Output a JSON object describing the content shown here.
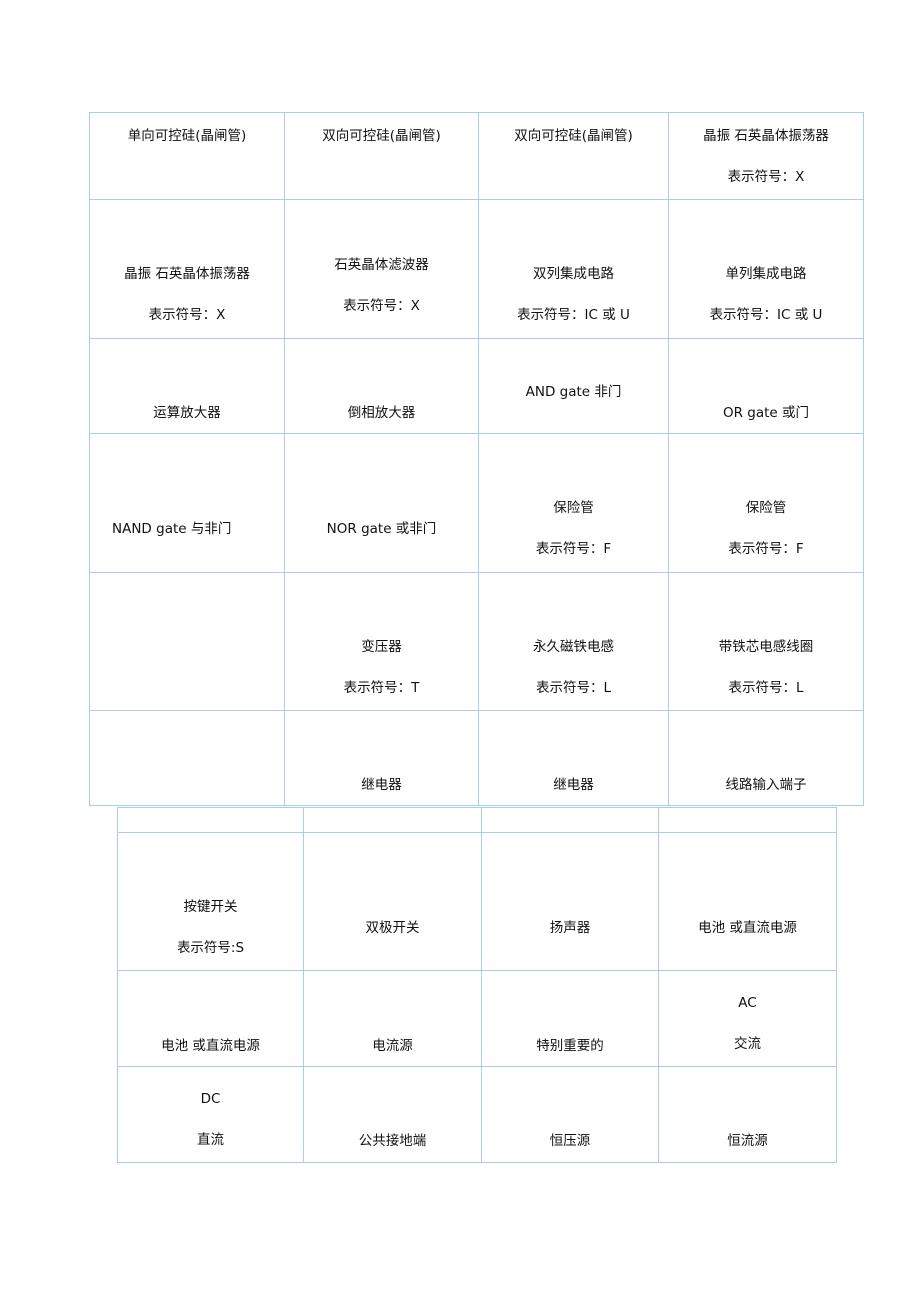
{
  "table1": {
    "rows": [
      [
        {
          "line1": "单向可控硅(晶闸管)",
          "line2": ""
        },
        {
          "line1": "双向可控硅(晶闸管)",
          "line2": ""
        },
        {
          "line1": "双向可控硅(晶闸管)",
          "line2": ""
        },
        {
          "line1": "晶振  石英晶体振荡器",
          "line2": "表示符号：X"
        }
      ],
      [
        {
          "line1": "晶振  石英晶体振荡器",
          "line2": "表示符号：X"
        },
        {
          "line1": "石英晶体滤波器",
          "line2": "表示符号：X"
        },
        {
          "line1": "双列集成电路",
          "line2": "表示符号：IC 或 U"
        },
        {
          "line1": "单列集成电路",
          "line2": "表示符号：IC 或 U"
        }
      ],
      [
        {
          "line1": "运算放大器",
          "line2": ""
        },
        {
          "line1": "倒相放大器",
          "line2": ""
        },
        {
          "line1": "AND gate  非门",
          "line2": ""
        },
        {
          "line1": "OR gate  或门",
          "line2": ""
        }
      ],
      [
        {
          "line1": "NAND gate 与非门",
          "line2": ""
        },
        {
          "line1": "NOR gate  或非门",
          "line2": ""
        },
        {
          "line1": "保险管",
          "line2": "表示符号：F"
        },
        {
          "line1": "保险管",
          "line2": "表示符号：F"
        }
      ],
      [
        {
          "line1": "",
          "line2": ""
        },
        {
          "line1": "变压器",
          "line2": "表示符号：T"
        },
        {
          "line1": "永久磁铁电感",
          "line2": "表示符号：L"
        },
        {
          "line1": "带铁芯电感线圈",
          "line2": "表示符号：L"
        }
      ],
      [
        {
          "line1": "",
          "line2": ""
        },
        {
          "line1": "继电器",
          "line2": ""
        },
        {
          "line1": "继电器",
          "line2": ""
        },
        {
          "line1": "线路输入端子",
          "line2": ""
        }
      ]
    ]
  },
  "table2": {
    "rows": [
      [
        {
          "line1": "",
          "line2": ""
        },
        {
          "line1": "",
          "line2": ""
        },
        {
          "line1": "",
          "line2": ""
        },
        {
          "line1": "",
          "line2": ""
        }
      ],
      [
        {
          "line1": "按键开关",
          "line2": "表示符号:S"
        },
        {
          "line1": "双极开关",
          "line2": ""
        },
        {
          "line1": "扬声器",
          "line2": ""
        },
        {
          "line1": "电池  或直流电源",
          "line2": ""
        }
      ],
      [
        {
          "line1": "电池  或直流电源",
          "line2": ""
        },
        {
          "line1": "电流源",
          "line2": ""
        },
        {
          "line1": "特别重要的",
          "line2": ""
        },
        {
          "line1": "AC",
          "line2": "交流"
        }
      ],
      [
        {
          "line1": "DC",
          "line2": "直流"
        },
        {
          "line1": "公共接地端",
          "line2": ""
        },
        {
          "line1": "恒压源",
          "line2": ""
        },
        {
          "line1": "恒流源",
          "line2": ""
        }
      ]
    ]
  }
}
